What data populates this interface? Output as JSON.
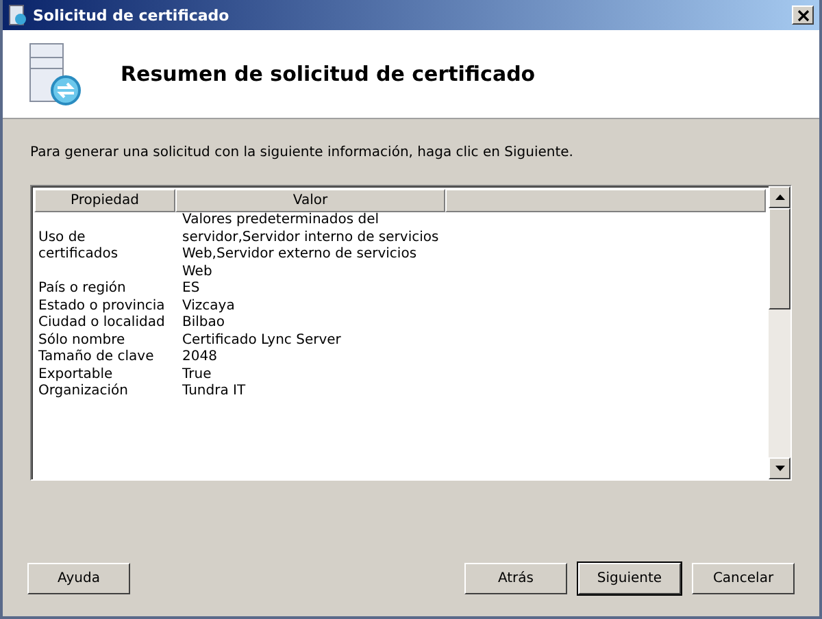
{
  "window": {
    "title": "Solicitud de certificado"
  },
  "header": {
    "title": "Resumen de solicitud de certificado"
  },
  "instruction": "Para generar una solicitud con la siguiente información, haga clic en Siguiente.",
  "table": {
    "columns": [
      "Propiedad",
      "Valor"
    ],
    "rows": [
      {
        "property": "Uso de certificados",
        "value": "Valores predeterminados del servidor,Servidor interno de servicios Web,Servidor externo de servicios Web"
      },
      {
        "property": "País o región",
        "value": "ES"
      },
      {
        "property": "Estado o provincia",
        "value": "Vizcaya"
      },
      {
        "property": "Ciudad o localidad",
        "value": "Bilbao"
      },
      {
        "property": "Sólo nombre",
        "value": "Certificado Lync Server"
      },
      {
        "property": "Tamaño de clave",
        "value": "2048"
      },
      {
        "property": "Exportable",
        "value": "True"
      },
      {
        "property": "Organización",
        "value": "Tundra IT"
      }
    ]
  },
  "buttons": [
    {
      "label": "Ayuda",
      "default": false,
      "kind": "left"
    },
    {
      "label": "Atrás",
      "default": false,
      "kind": "right"
    },
    {
      "label": "Siguiente",
      "default": true,
      "kind": "right"
    },
    {
      "label": "Cancelar",
      "default": false,
      "kind": "right"
    }
  ]
}
